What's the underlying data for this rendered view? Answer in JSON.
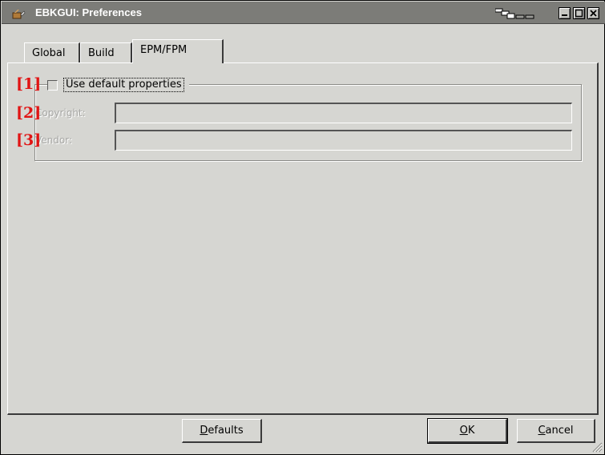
{
  "window": {
    "title": "EBKGUI: Preferences",
    "icons": {
      "app": "package-icon",
      "pager": "pager-icon"
    }
  },
  "tabs": [
    {
      "label": "Global",
      "active": false
    },
    {
      "label": "Build",
      "active": false
    },
    {
      "label": "EPM/FPM",
      "active": true
    }
  ],
  "group": {
    "checkbox_label": "Use default properties",
    "checked": false
  },
  "fields": {
    "copyright": {
      "label": "Copyright:",
      "value": "",
      "enabled": false
    },
    "vendor": {
      "label": "Vendor:",
      "value": "",
      "enabled": false
    }
  },
  "markers": [
    "[1]",
    "[2]",
    "[3]"
  ],
  "buttons": {
    "defaults": {
      "mnemonic": "D",
      "rest": "efaults"
    },
    "ok": {
      "mnemonic": "O",
      "rest": "K"
    },
    "cancel": {
      "mnemonic": "C",
      "rest": "ancel"
    }
  },
  "colors": {
    "titlebar": "#7c7c78",
    "window_bg": "#d6d6d2",
    "marker": "#e11414"
  }
}
